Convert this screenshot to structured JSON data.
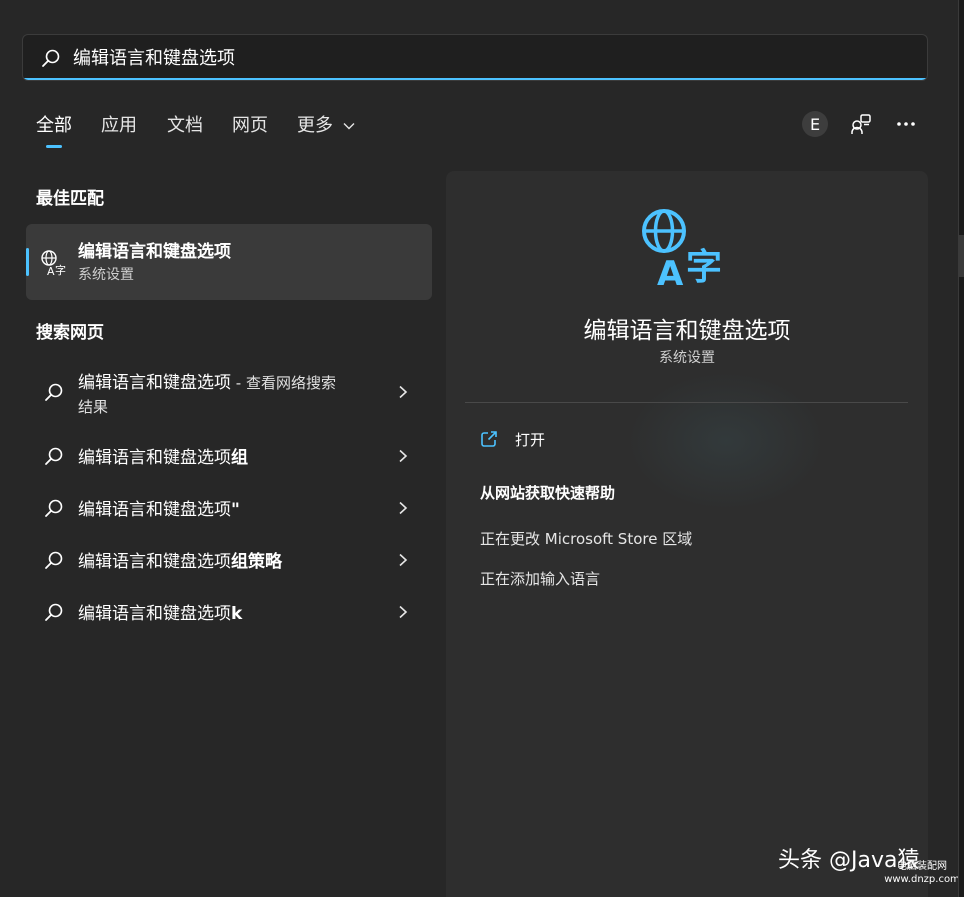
{
  "search": {
    "query": "编辑语言和键盘选项"
  },
  "tabs": [
    {
      "label": "全部",
      "active": true
    },
    {
      "label": "应用",
      "active": false
    },
    {
      "label": "文档",
      "active": false
    },
    {
      "label": "网页",
      "active": false
    },
    {
      "label": "更多",
      "active": false
    }
  ],
  "toolbar": {
    "account_initial": "E",
    "icons": [
      "share-devices-icon",
      "more-options-icon"
    ]
  },
  "best_match": {
    "heading": "最佳匹配",
    "title": "编辑语言和键盘选项",
    "subtitle": "系统设置",
    "icon": "language-icon"
  },
  "web_search": {
    "heading": "搜索网页",
    "items": [
      {
        "query": "编辑语言和键盘选项",
        "suffix": " - 查看网络搜索",
        "line2": "结果"
      },
      {
        "query": "编辑语言和键盘选项",
        "bold": "组"
      },
      {
        "query": "编辑语言和键盘选项",
        "bold": "\""
      },
      {
        "query": "编辑语言和键盘选项",
        "bold": "组策略"
      },
      {
        "query": "编辑语言和键盘选项",
        "bold": "k"
      }
    ]
  },
  "detail": {
    "title": "编辑语言和键盘选项",
    "subtitle": "系统设置",
    "open_label": "打开",
    "help_heading": "从网站获取快速帮助",
    "links": [
      "正在更改 Microsoft Store 区域",
      "正在添加输入语言"
    ]
  },
  "watermark": {
    "line1": "头条 @Java猿",
    "line2": "电脑装配网 www.dnzp.com"
  },
  "colors": {
    "accent": "#4cc2ff",
    "background": "#272727",
    "panel": "#2e2e2e"
  }
}
